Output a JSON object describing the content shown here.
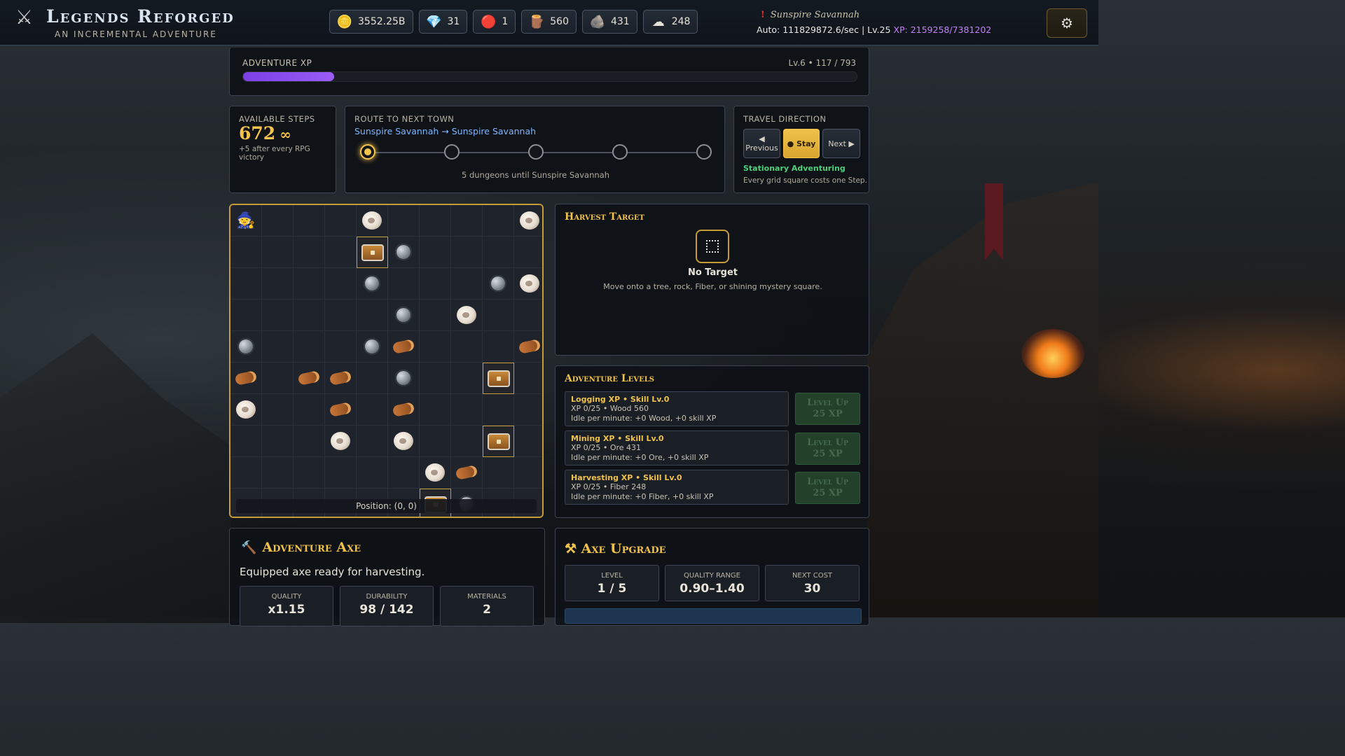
{
  "app": {
    "title": "Legends Reforged",
    "subtitle": "An Incremental Adventure"
  },
  "resources": [
    {
      "name": "gold",
      "icon": "coins-icon",
      "glyph": "🪙",
      "value": "3552.25B"
    },
    {
      "name": "gems",
      "icon": "diamond-icon",
      "glyph": "💎",
      "value": "31"
    },
    {
      "name": "crystals",
      "icon": "red-crystal-icon",
      "glyph": "🔴",
      "value": "1"
    },
    {
      "name": "wood",
      "icon": "wood-log-icon",
      "glyph": "🪵",
      "value": "560"
    },
    {
      "name": "ore",
      "icon": "ore-icon",
      "glyph": "🪨",
      "value": "431"
    },
    {
      "name": "fiber",
      "icon": "fiber-icon",
      "glyph": "☁",
      "value": "248"
    }
  ],
  "header": {
    "zone_alert": "!",
    "zone_name": "Sunspire Savannah",
    "auto_text": "Auto: 111829872.6/sec | Lv.25 ",
    "xp_text": "XP: 2159258/7381202"
  },
  "adventure_xp": {
    "label": "Adventure XP",
    "level_text": "Lv.6 • 117 / 793",
    "progress": 0.148
  },
  "steps": {
    "label": "Available Steps",
    "value": "672",
    "infinity": "∞",
    "note": "+5 after every RPG victory"
  },
  "route": {
    "label": "Route to Next Town",
    "link": "Sunspire Savannah → Sunspire Savannah",
    "nodes": 5,
    "active_node": 0,
    "note": "5 dungeons until Sunspire Savannah"
  },
  "travel": {
    "label": "Travel Direction",
    "previous_arrow": "◀",
    "previous_label": "Previous",
    "stay_label": "● Stay",
    "next_label": "Next ▶",
    "state": "Stationary Adventuring",
    "note": "Every grid square costs one Step."
  },
  "grid": {
    "position_text": "Position: (0, 0)",
    "rows": [
      [
        "P",
        "",
        "",
        "",
        "F",
        "",
        "",
        "",
        "",
        "F"
      ],
      [
        "",
        "",
        "",
        "",
        "C",
        "O",
        "",
        "",
        "",
        ""
      ],
      [
        "",
        "",
        "",
        "",
        "O",
        "",
        "",
        "",
        "O",
        "F"
      ],
      [
        "",
        "",
        "",
        "",
        "",
        "O",
        "",
        "F",
        "",
        ""
      ],
      [
        "O",
        "",
        "",
        "",
        "O",
        "W",
        "",
        "",
        "",
        "W"
      ],
      [
        "W",
        "",
        "W",
        "W",
        "",
        "O",
        "",
        "",
        "C",
        ""
      ],
      [
        "F",
        "",
        "",
        "W",
        "",
        "W",
        "",
        "",
        "",
        ""
      ],
      [
        "",
        "",
        "",
        "F",
        "",
        "F",
        "",
        "",
        "C",
        ""
      ],
      [
        "",
        "",
        "",
        "",
        "",
        "",
        "F",
        "W",
        "",
        ""
      ],
      [
        "",
        "",
        "",
        "",
        "",
        "",
        "C",
        "O",
        "",
        ""
      ]
    ]
  },
  "harvest": {
    "title": "Harvest Target",
    "target_name": "No Target",
    "note": "Move onto a tree, rock, Fiber, or shining mystery square."
  },
  "levels": {
    "title": "Adventure Levels",
    "rows": [
      {
        "title": "Logging XP • Skill Lv.0",
        "line1": "XP 0/25 • Wood 560",
        "line2": "Idle per minute: +0 Wood, +0 skill XP",
        "btn1": "Level Up",
        "btn2": "25 XP"
      },
      {
        "title": "Mining XP • Skill Lv.0",
        "line1": "XP 0/25 • Ore 431",
        "line2": "Idle per minute: +0 Ore, +0 skill XP",
        "btn1": "Level Up",
        "btn2": "25 XP"
      },
      {
        "title": "Harvesting XP • Skill Lv.0",
        "line1": "XP 0/25 • Fiber 248",
        "line2": "Idle per minute: +0 Fiber, +0 skill XP",
        "btn1": "Level Up",
        "btn2": "25 XP"
      }
    ]
  },
  "axe": {
    "title": "Adventure Axe",
    "description": "Equipped axe ready for harvesting.",
    "stats": [
      {
        "key": "Quality",
        "value": "x1.15"
      },
      {
        "key": "Durability",
        "value": "98 / 142"
      },
      {
        "key": "Materials",
        "value": "2"
      }
    ]
  },
  "upgrade": {
    "title": "⚒ Axe Upgrade",
    "stats": [
      {
        "key": "Level",
        "value": "1 / 5"
      },
      {
        "key": "Quality Range",
        "value": "0.90–1.40"
      },
      {
        "key": "Next Cost",
        "value": "30"
      }
    ]
  },
  "colors": {
    "accent_gold": "#f0c24a",
    "xp_purple": "#9b5cf6",
    "link_blue": "#7fb6ff",
    "status_green": "#4fd07a"
  }
}
